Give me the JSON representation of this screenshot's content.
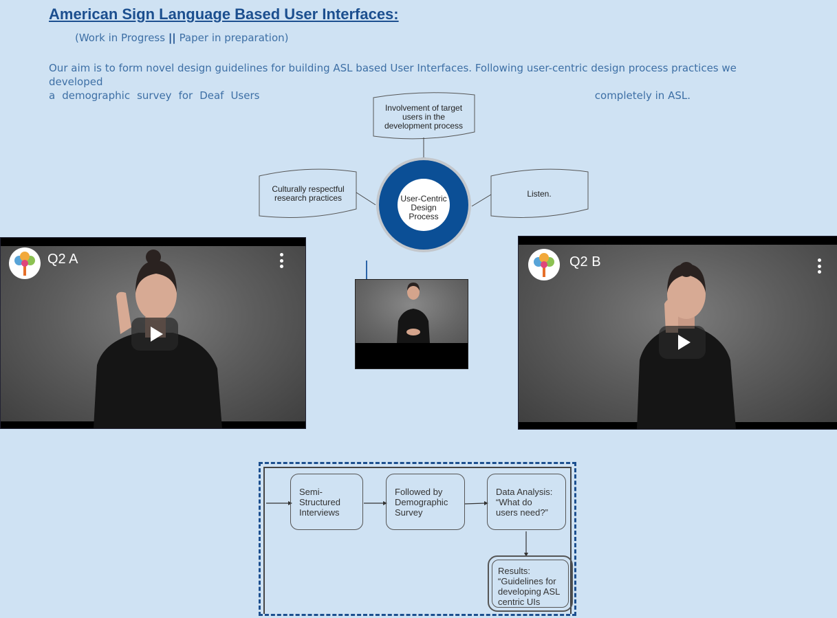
{
  "header": {
    "title": "American Sign Language Based User Interfaces:",
    "subtitle_left": "(Work in Progress ",
    "subtitle_sep": "||",
    "subtitle_right": " Paper in preparation)"
  },
  "intro": {
    "line1": "Our aim is to form novel design guidelines for building ASL based User Interfaces. Following user-centric design process practices we developed",
    "line2_words": [
      "a",
      "demographic",
      "survey",
      "for",
      "Deaf",
      "Users"
    ],
    "line2_end": "completely in ASL."
  },
  "diagram": {
    "center": "User-Centric Design Process",
    "top": "Involvement of target users in the development process",
    "left": "Culturally respectful research practices",
    "right": "Listen.",
    "ring_color": "#0b4f96"
  },
  "videos": {
    "left": {
      "title": "Q2 A",
      "logo_icon": "tree-logo-icon"
    },
    "right": {
      "title": "Q2 B",
      "logo_icon": "tree-logo-icon"
    }
  },
  "flow": {
    "step1": "Semi-\nStructured\nInterviews",
    "step2": "Followed by\nDemographic\nSurvey",
    "step3": "Data Analysis:\n“What do\nusers need?”",
    "result": "Results:\n“Guidelines for\ndeveloping ASL\ncentric UIs"
  },
  "colors": {
    "background": "#cfe2f3",
    "title": "#1c4f8f",
    "text": "#3d6fa5"
  }
}
